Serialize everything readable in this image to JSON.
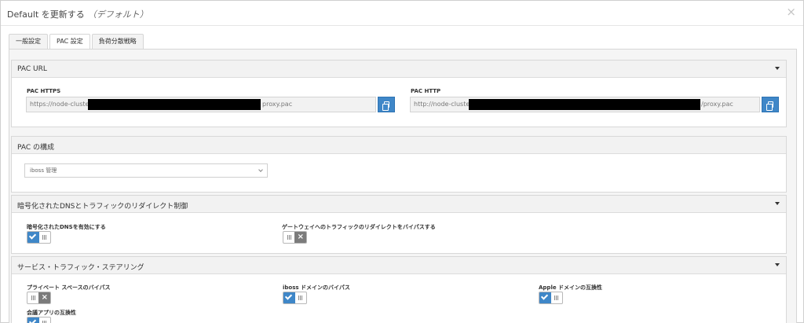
{
  "dialog": {
    "title": "Default を更新する",
    "title_sub": "（デフォルト）",
    "close_icon": "×"
  },
  "tabs": [
    {
      "label": "一般設定",
      "active": false
    },
    {
      "label": "PAC 設定",
      "active": true
    },
    {
      "label": "負荷分散戦略",
      "active": false
    }
  ],
  "pac_url": {
    "heading": "PAC URL",
    "https_label": "PAC HTTPS",
    "https_value_start": "https://node-cluste",
    "https_value_end": "proxy.pac",
    "http_label": "PAC HTTP",
    "http_value_start": "http://node-cluste",
    "http_value_end": "/proxy.pac"
  },
  "pac_config": {
    "heading": "PAC の構成",
    "selected": "iboss 管理"
  },
  "dns_redirect": {
    "heading": "暗号化されたDNSとトラフィックのリダイレクト制御",
    "enable_dns_label": "暗号化されたDNSを有効にする",
    "enable_dns_on": true,
    "bypass_gateway_label": "ゲートウェイへのトラフィックのリダイレクトをバイパスする",
    "bypass_gateway_on": false
  },
  "steering": {
    "heading": "サービス・トラフィック・ステアリング",
    "private_space_label": "プライベート スペースのバイパス",
    "private_space_on": false,
    "iboss_domain_label": "iboss ドメインのバイパス",
    "iboss_domain_on": true,
    "apple_domain_label": "Apple ドメインの互換性",
    "apple_domain_on": true,
    "meeting_app_label": "会議アプリの互換性",
    "meeting_app_on": true
  },
  "colors": {
    "accent": "#3f87c8",
    "toggle_off": "#7b7b7b",
    "panel_header": "#f2f2f2"
  }
}
